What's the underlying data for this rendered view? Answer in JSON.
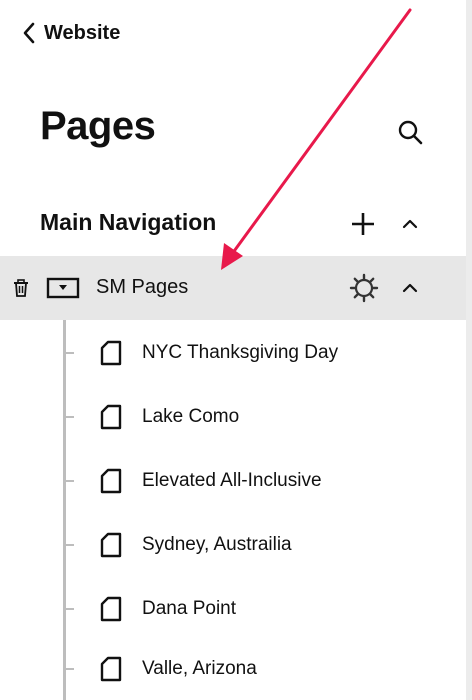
{
  "header": {
    "back_label": "Website"
  },
  "page": {
    "title": "Pages"
  },
  "navigation": {
    "section_title": "Main Navigation",
    "folder": {
      "label": "SM Pages",
      "pages": [
        {
          "label": "NYC Thanksgiving Day"
        },
        {
          "label": "Lake Como"
        },
        {
          "label": "Elevated All-Inclusive"
        },
        {
          "label": "Sydney, Austrailia"
        },
        {
          "label": "Dana Point"
        },
        {
          "label": "Valle, Arizona"
        }
      ]
    }
  },
  "annotation": {
    "arrow_color": "#e8194b"
  },
  "icons": [
    "chevron-left-icon",
    "search-icon",
    "plus-icon",
    "chevron-up-icon",
    "trash-icon",
    "folder-icon",
    "gear-icon",
    "page-icon"
  ]
}
